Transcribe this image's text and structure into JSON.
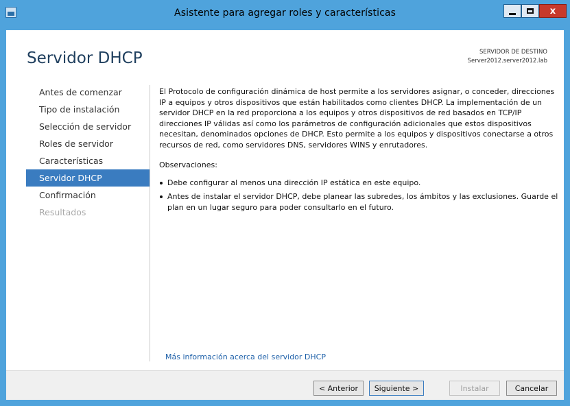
{
  "window": {
    "title": "Asistente para agregar roles y características",
    "close_glyph": "x"
  },
  "page": {
    "title": "Servidor DHCP",
    "destination_label": "SERVIDOR DE DESTINO",
    "destination_server": "Server2012.server2012.lab"
  },
  "nav": {
    "items": [
      {
        "label": "Antes de comenzar",
        "state": "normal"
      },
      {
        "label": "Tipo de instalación",
        "state": "normal"
      },
      {
        "label": "Selección de servidor",
        "state": "normal"
      },
      {
        "label": "Roles de servidor",
        "state": "normal"
      },
      {
        "label": "Características",
        "state": "normal"
      },
      {
        "label": "Servidor DHCP",
        "state": "active"
      },
      {
        "label": "Confirmación",
        "state": "normal"
      },
      {
        "label": "Resultados",
        "state": "disabled"
      }
    ]
  },
  "content": {
    "description": "El Protocolo de configuración dinámica de host permite a los servidores asignar, o conceder, direcciones IP a equipos y otros dispositivos que están habilitados como clientes DHCP. La implementación de un servidor DHCP en la red proporciona a los equipos y otros dispositivos de red basados en TCP/IP direcciones IP válidas así como los parámetros de configuración adicionales que estos dispositivos necesitan, denominados opciones de DHCP. Esto permite a los equipos y dispositivos conectarse a otros recursos de red, como servidores DNS, servidores WINS y enrutadores.",
    "observations_title": "Observaciones:",
    "bullets": [
      "Debe configurar al menos una dirección IP estática en este equipo.",
      "Antes de instalar el servidor DHCP, debe planear las subredes, los ámbitos y las exclusiones. Guarde el plan en un lugar seguro para poder consultarlo en el futuro."
    ],
    "more_info_link": "Más información acerca del servidor DHCP"
  },
  "footer": {
    "previous": "< Anterior",
    "next": "Siguiente >",
    "install": "Instalar",
    "cancel": "Cancelar"
  },
  "colors": {
    "window_frame": "#4fa3dc",
    "nav_active": "#3a7cc0",
    "link": "#1c5fa8",
    "close_button": "#c7392b"
  }
}
